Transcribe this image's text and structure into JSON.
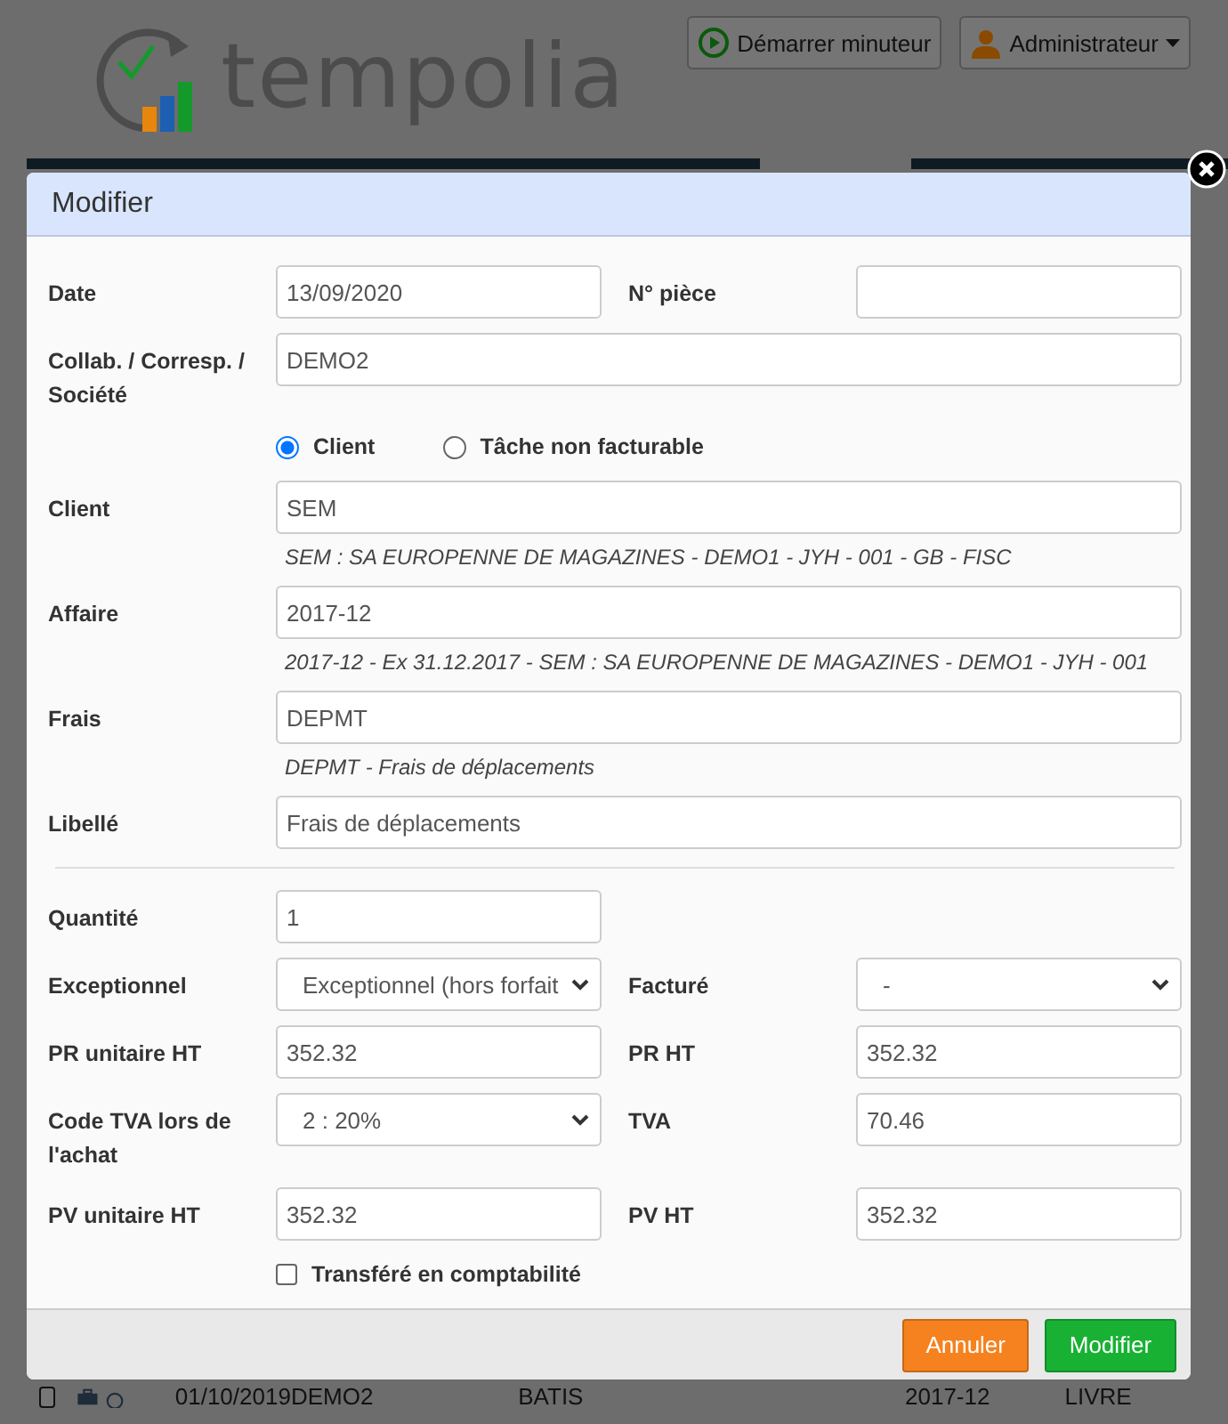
{
  "header": {
    "logo_text": "tempolia",
    "buttons": [
      {
        "kind": "timer",
        "label": "Démarrer minuteur"
      },
      {
        "kind": "user_menu",
        "label": "Administrateur"
      }
    ]
  },
  "dialog": {
    "title": "Modifier",
    "rows": [
      {
        "kind": "pair",
        "left": {
          "label": "Date",
          "kind": "input",
          "value": "13/09/2020"
        },
        "right": {
          "label": "N° pièce",
          "kind": "input"
        }
      },
      {
        "kind": "full",
        "label": "Collab. / Corresp. / Société",
        "value": "DEMO2"
      },
      {
        "kind": "radios",
        "options": [
          {
            "label": "Client",
            "selected": true
          },
          {
            "label": "Tâche non facturable",
            "selected": false
          }
        ]
      },
      {
        "kind": "full",
        "label": "Client",
        "value": "SEM",
        "hint": "SEM : SA EUROPENNE DE MAGAZINES - DEMO1 - JYH - 001 - GB - FISC"
      },
      {
        "kind": "full",
        "label": "Affaire",
        "value": "2017-12",
        "hint": "2017-12 - Ex 31.12.2017 - SEM : SA EUROPENNE DE MAGAZINES - DEMO1 - JYH - 001"
      },
      {
        "kind": "full",
        "label": "Frais",
        "value": "DEPMT",
        "hint": "DEPMT - Frais de déplacements"
      },
      {
        "kind": "full",
        "label": "Libellé",
        "value": "Frais de déplacements"
      },
      {
        "kind": "divider"
      },
      {
        "kind": "pair",
        "left": {
          "label": "Quantité",
          "kind": "input",
          "value": "1"
        }
      },
      {
        "kind": "pair",
        "left": {
          "label": "Exceptionnel",
          "kind": "select",
          "value": "Exceptionnel (hors forfait"
        },
        "right": {
          "label": "Facturé",
          "kind": "select",
          "value": "-"
        }
      },
      {
        "kind": "pair",
        "left": {
          "label": "PR unitaire HT",
          "kind": "input",
          "value": "352.32"
        },
        "right": {
          "label": "PR HT",
          "kind": "input",
          "value": "352.32"
        }
      },
      {
        "kind": "pair",
        "left": {
          "label": "Code TVA lors de l'achat",
          "kind": "select",
          "value": "2 : 20%"
        },
        "right": {
          "label": "TVA",
          "kind": "input",
          "value": "70.46"
        }
      },
      {
        "kind": "pair",
        "left": {
          "label": "PV unitaire HT",
          "kind": "input",
          "value": "352.32"
        },
        "right": {
          "label": "PV HT",
          "kind": "input",
          "value": "352.32"
        }
      },
      {
        "kind": "checkbox",
        "label": "Transféré en comptabilité",
        "checked": false
      }
    ],
    "buttons": [
      {
        "kind": "cancel",
        "label": "Annuler"
      },
      {
        "kind": "confirm",
        "label": "Modifier"
      }
    ]
  },
  "background_row": {
    "checked": false,
    "cells": [
      "01/10/2019",
      "DEMO2",
      "BATIS",
      "2017-12",
      "LIVRE"
    ]
  }
}
